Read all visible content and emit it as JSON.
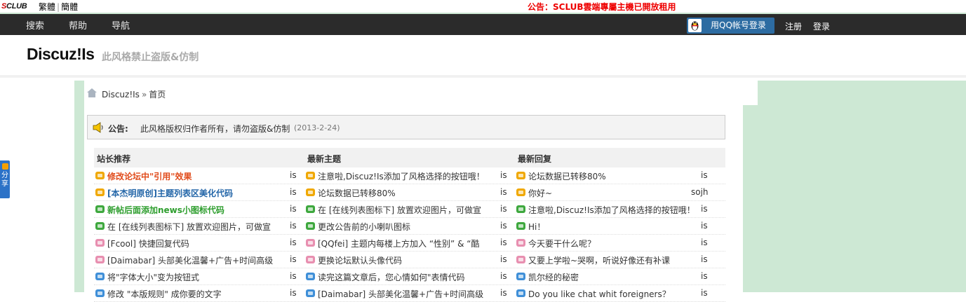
{
  "topbar": {
    "brand": "SCLUB",
    "lang_traditional": "繁體",
    "lang_separator": "|",
    "lang_simplified": "簡體",
    "notice": "公告：SCLUB雲端專屬主機已開放租用"
  },
  "nav": {
    "items": [
      "搜索",
      "帮助",
      "导航"
    ],
    "qq_login": "用QQ帐号登录",
    "register": "注册",
    "login": "登录"
  },
  "header": {
    "logo": "Discuz!Is",
    "tagline": "此风格禁止盗版&仿制"
  },
  "breadcrumb": {
    "site": "Discuz!Is",
    "separator": "»",
    "current": "首页"
  },
  "share": {
    "label": "分享"
  },
  "announcement": {
    "label": "公告:",
    "text": "此风格版权归作者所有，请勿盗版&仿制",
    "date": "(2013-2-24)"
  },
  "table": {
    "headers": [
      "站长推荐",
      "最新主题",
      "最新回复"
    ],
    "rows": [
      [
        {
          "title": "修改论坛中\"引用\"效果",
          "author": "is",
          "style": "red",
          "icon": "orange"
        },
        {
          "title": "注意啦,Discuz!Is添加了风格选择的按钮哦！",
          "author": "is",
          "style": "",
          "icon": "orange"
        },
        {
          "title": "论坛数据已转移80%",
          "author": "is",
          "style": "",
          "icon": "orange"
        }
      ],
      [
        {
          "title": "[本杰明原创]主题列表区美化代码",
          "author": "is",
          "style": "blue",
          "icon": "orange"
        },
        {
          "title": "论坛数据已转移80%",
          "author": "is",
          "style": "",
          "icon": "orange"
        },
        {
          "title": "你好~",
          "author": "sojh",
          "style": "",
          "icon": "orange"
        }
      ],
      [
        {
          "title": "新帖后面添加news小图标代码",
          "author": "is",
          "style": "green",
          "icon": "green"
        },
        {
          "title": "在 [在线列表图标下] 放置欢迎图片，可做宣",
          "author": "is",
          "style": "",
          "icon": "green"
        },
        {
          "title": "注意啦,Discuz!Is添加了风格选择的按钮哦！",
          "author": "is",
          "style": "",
          "icon": "green"
        }
      ],
      [
        {
          "title": "在 [在线列表图标下] 放置欢迎图片，可做宣",
          "author": "is",
          "style": "",
          "icon": "green"
        },
        {
          "title": "更改公告前的小喇叭图标",
          "author": "is",
          "style": "",
          "icon": "green"
        },
        {
          "title": "Hi！",
          "author": "is",
          "style": "",
          "icon": "green"
        }
      ],
      [
        {
          "title": "[Fcool] 快捷回复代码",
          "author": "is",
          "style": "",
          "icon": "pink"
        },
        {
          "title": "[QQfei] 主题内每楼上方加入 “性别” & “酷",
          "author": "is",
          "style": "",
          "icon": "pink"
        },
        {
          "title": "今天要干什么呢？",
          "author": "is",
          "style": "",
          "icon": "pink"
        }
      ],
      [
        {
          "title": "[Daimabar] 头部美化温馨+广告+时间高级",
          "author": "is",
          "style": "",
          "icon": "pink"
        },
        {
          "title": "更换论坛默认头像代码",
          "author": "is",
          "style": "",
          "icon": "pink"
        },
        {
          "title": "又要上学啦~哭啊，听说好像还有补课",
          "author": "is",
          "style": "",
          "icon": "pink"
        }
      ],
      [
        {
          "title": "将\"字体大小\"变为按钮式",
          "author": "is",
          "style": "",
          "icon": "blue"
        },
        {
          "title": "读完这篇文章后，您心情如何\"表情代码",
          "author": "is",
          "style": "",
          "icon": "blue"
        },
        {
          "title": "凯尔经的秘密",
          "author": "is",
          "style": "",
          "icon": "blue"
        }
      ],
      [
        {
          "title": "修改 \"本版规则\" 成你要的文字",
          "author": "is",
          "style": "",
          "icon": "blue"
        },
        {
          "title": "[Daimabar] 头部美化温馨+广告+时间高级",
          "author": "is",
          "style": "",
          "icon": "blue"
        },
        {
          "title": "Do you like chat whit foreigners？",
          "author": "is",
          "style": "",
          "icon": "blue"
        }
      ]
    ]
  },
  "colors": {
    "nav_bg": "#2b2b2b",
    "qq_button": "#2d6ca2",
    "page_green": "#cde8d4",
    "notice_red": "#ee0000",
    "icon_orange": "#f0a800",
    "icon_green": "#3ea83e",
    "icon_pink": "#e88fb0",
    "icon_blue": "#3f8fd8"
  }
}
